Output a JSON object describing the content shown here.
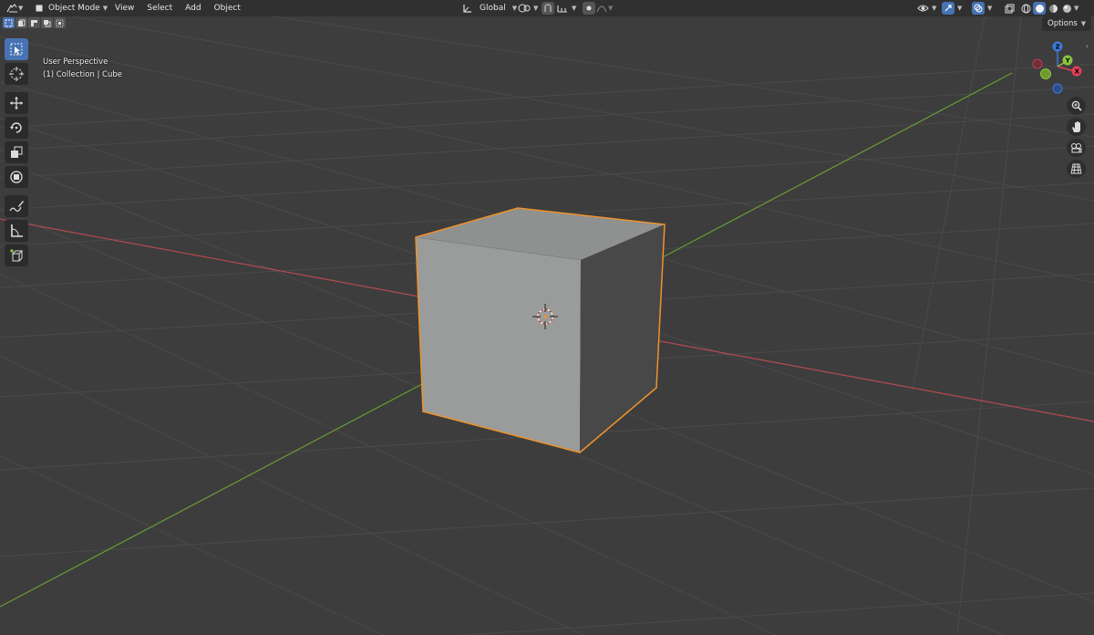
{
  "menus": {
    "mode_label": "Object Mode",
    "view": "View",
    "select": "Select",
    "add": "Add",
    "object": "Object"
  },
  "header": {
    "orientation_label": "Global",
    "options_label": "Options"
  },
  "viewport": {
    "perspective_label": "User Perspective",
    "collection_label": "(1) Collection | Cube"
  },
  "gizmo": {
    "z_label": "Z",
    "y_label": "Y",
    "x_label": "X"
  },
  "colors": {
    "background": "#3d3d3d",
    "x_axis": "#b54a4f",
    "y_axis": "#6a9b35",
    "selection_outline": "#f0922a",
    "active_tool": "#4772b3"
  },
  "icons": {
    "tools": [
      "select-box-icon",
      "cursor-icon",
      "move-icon",
      "rotate-icon",
      "scale-icon",
      "transform-icon",
      "annotate-icon",
      "measure-icon",
      "add-cube-icon"
    ],
    "nav": [
      "zoom-icon",
      "pan-hand-icon",
      "camera-icon",
      "grid-icon"
    ]
  }
}
